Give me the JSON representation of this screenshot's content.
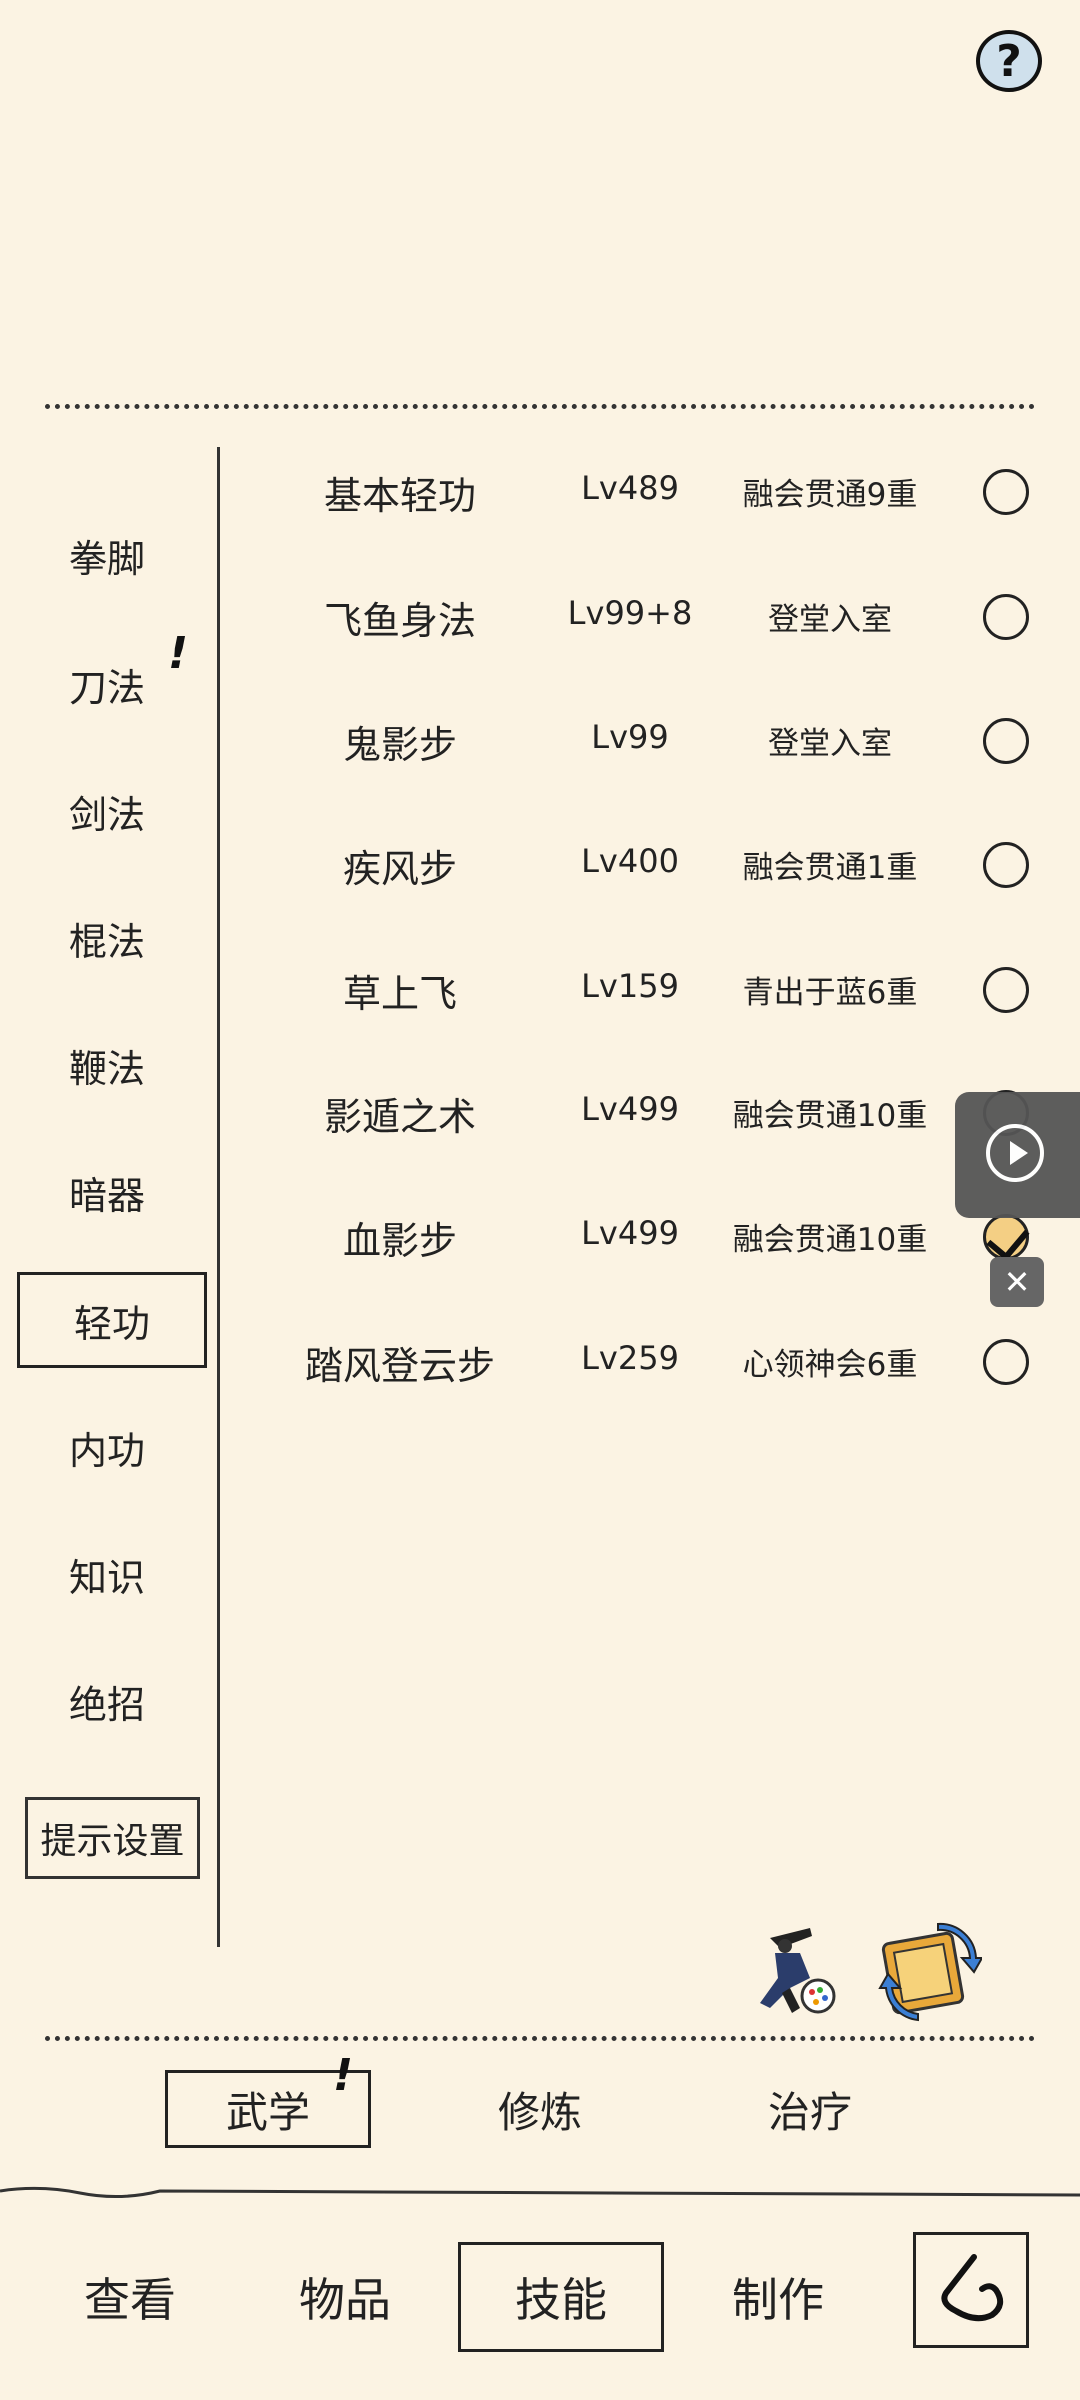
{
  "help": {
    "label": "?"
  },
  "categories": [
    {
      "label": "拳脚"
    },
    {
      "label": "刀法"
    },
    {
      "label": "剑法"
    },
    {
      "label": "棍法"
    },
    {
      "label": "鞭法"
    },
    {
      "label": "暗器"
    },
    {
      "label": "轻功"
    },
    {
      "label": "内功"
    },
    {
      "label": "知识"
    },
    {
      "label": "绝招"
    }
  ],
  "selected_category": "轻功",
  "hint_settings": "提示设置",
  "alert_mark": "!",
  "skills": [
    {
      "name": "基本轻功",
      "level": "Lv489",
      "rank": "融会贯通9重",
      "checked": false
    },
    {
      "name": "飞鱼身法",
      "level": "Lv99+8",
      "rank": "登堂入室",
      "checked": false
    },
    {
      "name": "鬼影步",
      "level": "Lv99",
      "rank": "登堂入室",
      "checked": false
    },
    {
      "name": "疾风步",
      "level": "Lv400",
      "rank": "融会贯通1重",
      "checked": false
    },
    {
      "name": "草上飞",
      "level": "Lv159",
      "rank": "青出于蓝6重",
      "checked": false
    },
    {
      "name": "影遁之术",
      "level": "Lv499",
      "rank": "融会贯通10重",
      "checked": false
    },
    {
      "name": "血影步",
      "level": "Lv499",
      "rank": "融会贯通10重",
      "checked": true
    },
    {
      "name": "踏风登云步",
      "level": "Lv259",
      "rank": "心领神会6重",
      "checked": false
    }
  ],
  "float_close": "✕",
  "sub_tabs": [
    {
      "label": "武学"
    },
    {
      "label": "修炼"
    },
    {
      "label": "治疗"
    }
  ],
  "bottom_nav": [
    {
      "label": "查看"
    },
    {
      "label": "物品"
    },
    {
      "label": "技能"
    },
    {
      "label": "制作"
    }
  ],
  "colors": {
    "background": "#fbf3e3",
    "checked_fill": "#f4cf84",
    "float_panel": "#555555"
  }
}
